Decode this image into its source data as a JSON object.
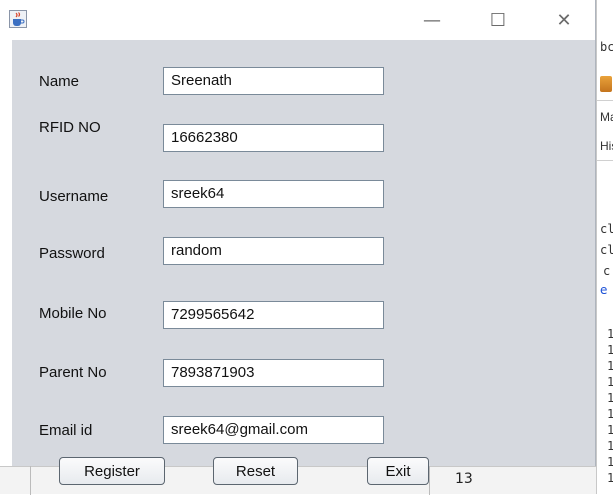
{
  "window": {
    "title": "",
    "controls": {
      "minimize": "—",
      "maximize": "☐",
      "close": "✕"
    }
  },
  "form": {
    "fields": [
      {
        "label": "Name",
        "value": "Sreenath"
      },
      {
        "label": "RFID NO",
        "value": "16662380"
      },
      {
        "label": "Username",
        "value": "sreek64"
      },
      {
        "label": "Password",
        "value": "random"
      },
      {
        "label": "Mobile No",
        "value": "7299565642"
      },
      {
        "label": "Parent No",
        "value": "7893871903"
      },
      {
        "label": "Email id",
        "value": "sreek64@gmail.com"
      }
    ],
    "buttons": {
      "register": "Register",
      "reset": "Reset",
      "exit": "Exit"
    }
  },
  "background_app": {
    "fragments": [
      "bc",
      "Ma",
      "His",
      "cl",
      "cl",
      "c",
      "e",
      "1",
      "1",
      "1",
      "1",
      "1",
      "1",
      "1",
      "1",
      "1",
      "1"
    ],
    "bottom_number": "13"
  }
}
